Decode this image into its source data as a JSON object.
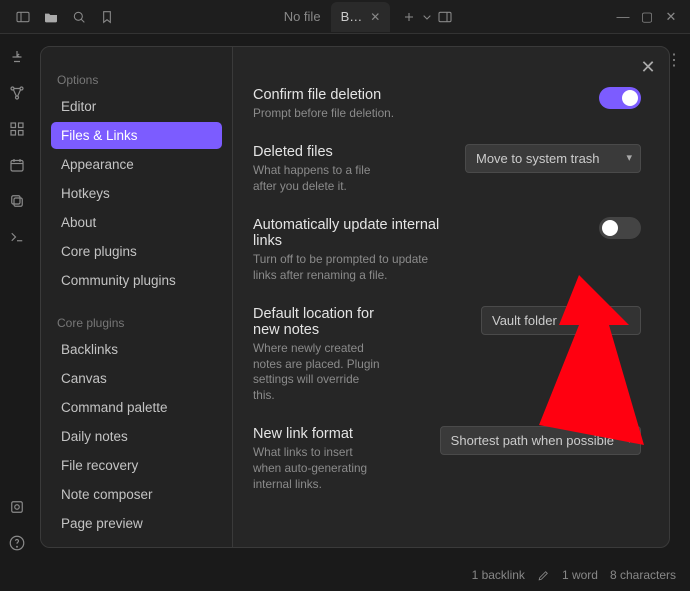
{
  "titlebar": {
    "tab_inactive": "No file",
    "tab_active": "B…"
  },
  "options": {
    "header": "Options",
    "items": [
      "Editor",
      "Files & Links",
      "Appearance",
      "Hotkeys",
      "About",
      "Core plugins",
      "Community plugins"
    ],
    "active_index": 1
  },
  "core_plugins": {
    "header": "Core plugins",
    "items": [
      "Backlinks",
      "Canvas",
      "Command palette",
      "Daily notes",
      "File recovery",
      "Note composer",
      "Page preview"
    ]
  },
  "settings": {
    "confirm_delete": {
      "title": "Confirm file deletion",
      "desc": "Prompt before file deletion.",
      "value": true
    },
    "deleted_files": {
      "title": "Deleted files",
      "desc": "What happens to a file after you delete it.",
      "selected": "Move to system trash"
    },
    "auto_update_links": {
      "title": "Automatically update internal links",
      "desc": "Turn off to be prompted to update links after renaming a file.",
      "value": false
    },
    "default_location": {
      "title": "Default location for new notes",
      "desc": "Where newly created notes are placed. Plugin settings will override this.",
      "selected": "Vault folder"
    },
    "new_link_format": {
      "title": "New link format",
      "desc": "What links to insert when auto-generating internal links.",
      "selected": "Shortest path when possible"
    }
  },
  "status": {
    "backlinks": "1 backlink",
    "words": "1 word",
    "chars": "8 characters"
  }
}
